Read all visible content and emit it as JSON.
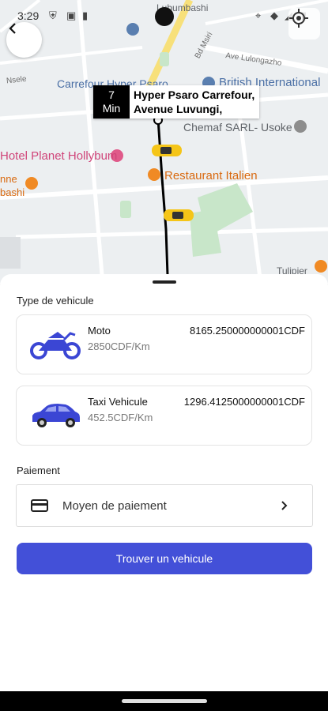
{
  "status_bar": {
    "time": "3:29",
    "icons": [
      "shield-icon",
      "a-icon",
      "sd-card-icon",
      "location-icon",
      "wifi-icon",
      "signal-icon",
      "battery-icon"
    ]
  },
  "map": {
    "labels": {
      "lubumbashi": "Lubumbashi",
      "carrefour": "Carrefour Hyper Psaro",
      "british": "British International",
      "chemaf": "Chemaf SARL- Usoke",
      "hotel": "Hotel Planet Hollybum",
      "restaurant": "Restaurant Italien",
      "nne": "nne",
      "bashi": "bashi",
      "tulipier": "Tulipier",
      "av_lulongazho": "Ave Lulongazho",
      "bd_msiri": "Bd Msiri",
      "nsele": "Nsele"
    },
    "eta": {
      "minutes": "7",
      "unit": "Min",
      "address_line1": "Hyper Psaro Carrefour,",
      "address_line2": "Avenue Luvungi,"
    },
    "colors": {
      "route": "#000000",
      "taxi": "#f5c518",
      "park": "#c8e6c9"
    }
  },
  "sheet": {
    "vehicle_type_title": "Type de vehicule",
    "vehicles": [
      {
        "name": "Moto",
        "rate": "2850CDF/Km",
        "price": "8165.250000000001CDF",
        "icon": "motorcycle-icon"
      },
      {
        "name": "Taxi Vehicule",
        "rate": "452.5CDF/Km",
        "price": "1296.4125000000001CDF",
        "icon": "car-icon"
      }
    ],
    "payment_title": "Paiement",
    "payment_method_label": "Moyen de paiement",
    "find_button_label": "Trouver un vehicule",
    "accent_color": "#4350d8"
  }
}
